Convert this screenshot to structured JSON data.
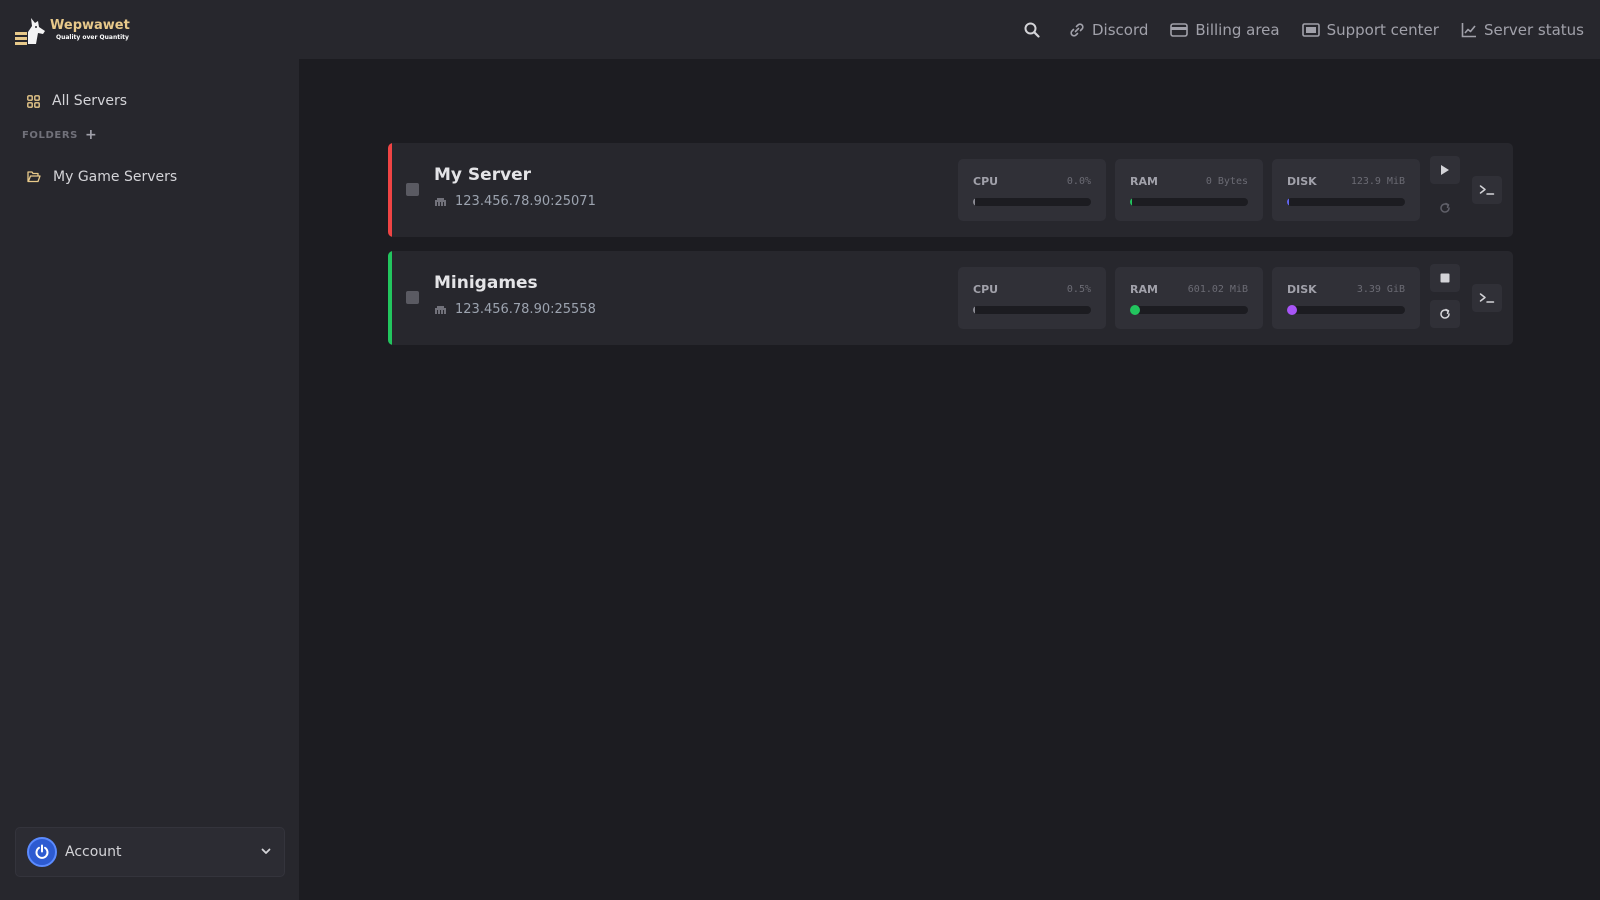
{
  "brand": {
    "name": "Wepwawet",
    "tagline": "Quality over Quantity"
  },
  "topnav": {
    "search_icon": "search-icon",
    "items": [
      {
        "label": "Discord",
        "icon": "link-icon"
      },
      {
        "label": "Billing area",
        "icon": "credit-card-icon"
      },
      {
        "label": "Support center",
        "icon": "ticket-icon"
      },
      {
        "label": "Server status",
        "icon": "chart-line-icon"
      }
    ]
  },
  "sidebar": {
    "all_servers": "All Servers",
    "folders_label": "FOLDERS",
    "folders_add": "+",
    "folders": [
      {
        "label": "My Game Servers"
      }
    ],
    "account_label": "Account"
  },
  "colors": {
    "offline": "#ef4444",
    "online": "#22c55e",
    "ram_dot": "#22c55e",
    "disk_dot": "#a855f7",
    "brand": "#e8c98a"
  },
  "servers": [
    {
      "name": "My Server",
      "address": "123.456.78.90:25071",
      "status": "offline",
      "cpu": {
        "label": "CPU",
        "value": "0.0%",
        "fraction": 0.0
      },
      "ram": {
        "label": "RAM",
        "value": "0 Bytes",
        "fraction": 0.0
      },
      "disk": {
        "label": "DISK",
        "value": "123.9 MiB",
        "fraction": 0.01
      }
    },
    {
      "name": "Minigames",
      "address": "123.456.78.90:25558",
      "status": "online",
      "cpu": {
        "label": "CPU",
        "value": "0.5%",
        "fraction": 0.005
      },
      "ram": {
        "label": "RAM",
        "value": "601.02 MiB",
        "fraction": 0.06
      },
      "disk": {
        "label": "DISK",
        "value": "3.39 GiB",
        "fraction": 0.06
      }
    }
  ]
}
